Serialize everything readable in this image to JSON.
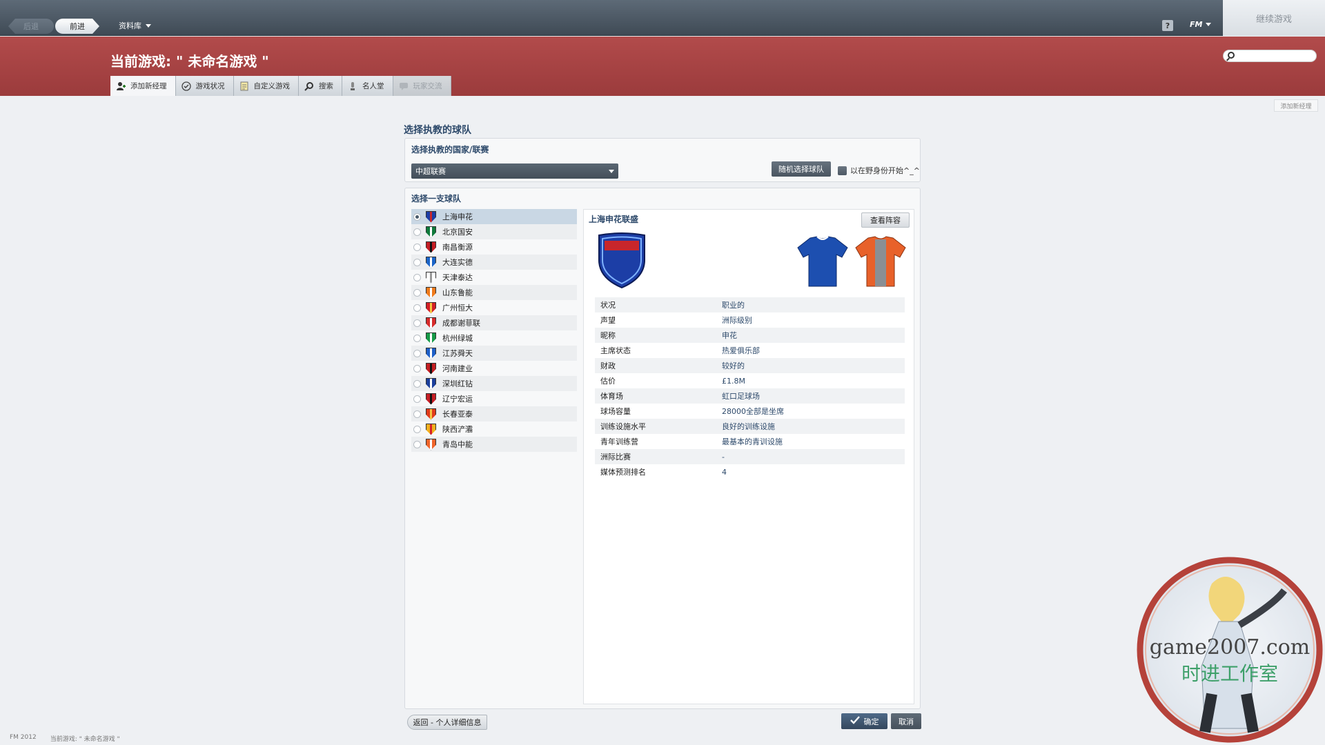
{
  "topbar": {
    "back_label": "后退",
    "forward_label": "前进",
    "resources_label": "资料库",
    "help_label": "?",
    "fm_label": "FM",
    "continue_label": "继续游戏"
  },
  "header": {
    "title": "当前游戏: \" 未命名游戏 \"",
    "search_placeholder": "",
    "tabs": [
      {
        "label": "添加新经理",
        "icon": "add-manager-icon"
      },
      {
        "label": "游戏状况",
        "icon": "check-circle-icon"
      },
      {
        "label": "自定义游戏",
        "icon": "notepad-icon"
      },
      {
        "label": "搜索",
        "icon": "search-icon"
      },
      {
        "label": "名人堂",
        "icon": "trophy-icon"
      },
      {
        "label": "玩家交流",
        "icon": "chat-icon"
      }
    ]
  },
  "side_label": "添加新经理",
  "main": {
    "section_title": "选择执教的球队",
    "country_heading": "选择执教的国家/联赛",
    "league_selected": "中超联赛",
    "random_team_label": "随机选择球队",
    "unemployed_label": "以在野身份开始^_^",
    "team_heading": "选择一支球队",
    "teams": [
      {
        "name": "上海申花",
        "color": "#1c3ea6",
        "accent": "#c8262b"
      },
      {
        "name": "北京国安",
        "color": "#0f7a3b",
        "accent": "#ffffff"
      },
      {
        "name": "南昌衡源",
        "color": "#c51d24",
        "accent": "#111111"
      },
      {
        "name": "大连实德",
        "color": "#1a64c8",
        "accent": "#ffffff"
      },
      {
        "name": "天津泰达",
        "color": "#ffffff",
        "accent": "#999999"
      },
      {
        "name": "山东鲁能",
        "color": "#f07a1a",
        "accent": "#ffffff"
      },
      {
        "name": "广州恒大",
        "color": "#d31f26",
        "accent": "#f5c542"
      },
      {
        "name": "成都谢菲联",
        "color": "#d62a2a",
        "accent": "#ffffff"
      },
      {
        "name": "杭州绿城",
        "color": "#169a47",
        "accent": "#ffffff"
      },
      {
        "name": "江苏舜天",
        "color": "#1d5fc8",
        "accent": "#ffffff"
      },
      {
        "name": "河南建业",
        "color": "#c41e22",
        "accent": "#111111"
      },
      {
        "name": "深圳红钻",
        "color": "#1b3f9c",
        "accent": "#ffffff"
      },
      {
        "name": "辽宁宏运",
        "color": "#c61e25",
        "accent": "#111111"
      },
      {
        "name": "长春亚泰",
        "color": "#e03a1a",
        "accent": "#f5c542"
      },
      {
        "name": "陕西浐灞",
        "color": "#f2b01e",
        "accent": "#d5202a"
      },
      {
        "name": "青岛中能",
        "color": "#f0642a",
        "accent": "#ffffff"
      }
    ],
    "selected_index": 0,
    "club": {
      "name": "上海申花联盛",
      "view_squad_label": "查看阵容",
      "crest_color": "#1c3ea6",
      "crest_accent": "#c8262b",
      "home_kit_color": "#1d4fb0",
      "away_kit_color": "#e8612a",
      "away_kit_stripe": "#8a8f94",
      "info": [
        {
          "label": "状况",
          "value": "职业的"
        },
        {
          "label": "声望",
          "value": "洲际级别"
        },
        {
          "label": "昵称",
          "value": "申花"
        },
        {
          "label": "主席状态",
          "value": "热爱俱乐部"
        },
        {
          "label": "财政",
          "value": "较好的"
        },
        {
          "label": "估价",
          "value": "£1.8M"
        },
        {
          "label": "体育场",
          "value": "虹口足球场"
        },
        {
          "label": "球场容量",
          "value": "28000全部是坐席"
        },
        {
          "label": "训练设施水平",
          "value": "良好的训练设施"
        },
        {
          "label": "青年训练营",
          "value": "最基本的青训设施"
        },
        {
          "label": "洲际比赛",
          "value": "-"
        },
        {
          "label": "媒体预测排名",
          "value": "4"
        }
      ]
    },
    "back_detail_label": "返回 - 个人详细信息",
    "confirm_label": "确定",
    "cancel_label": "取消"
  },
  "statusbar": {
    "version": "FM 2012",
    "game": "当前游戏: \" 未命名游戏 \""
  },
  "watermark": {
    "site": "game2007.com",
    "studio": "时进工作室"
  }
}
